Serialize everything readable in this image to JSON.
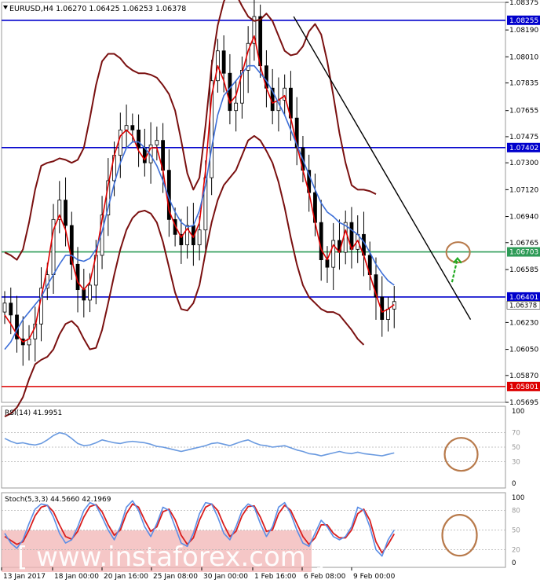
{
  "chart_data": [
    {
      "type": "line",
      "panel": "main",
      "title": "EURUSD,H4  1.06270 1.06425 1.06253 1.06378",
      "instrument": "EURUSD,H4",
      "ohlc_header": [
        "1.06270",
        "1.06425",
        "1.06253",
        "1.06378"
      ],
      "last_price": 1.06378,
      "last_price_label": "1.06378",
      "ylim": [
        1.05695,
        1.08375
      ],
      "y_ticks": [
        1.08375,
        1.0819,
        1.0801,
        1.07835,
        1.0765,
        1.07475,
        1.073,
        1.0712,
        1.0694,
        1.06765,
        1.06585,
        1.0623,
        1.0605,
        1.05875,
        1.05695
      ],
      "y_tick_labels": [
        "1.08375",
        "1.08190",
        "1.08010",
        "1.07835",
        "1.07655",
        "1.07475",
        "1.07300",
        "1.07120",
        "1.06940",
        "1.06765",
        "1.06585",
        "1.06230",
        "1.06050",
        "1.05870",
        "1.05695"
      ],
      "x_tick_labels": [
        "13 Jan 2017",
        "18 Jan 00:00",
        "20 Jan 16:00",
        "25 Jan 08:00",
        "30 Jan 00:00",
        "1 Feb 16:00",
        "6 Feb 08:00",
        "9 Feb 00:00"
      ],
      "levels": [
        {
          "value": 1.08255,
          "label": "1.08255",
          "color": "#0000cc"
        },
        {
          "value": 1.07402,
          "label": "1.07402",
          "color": "#0000cc"
        },
        {
          "value": 1.06703,
          "label": "1.06703",
          "color": "#2e9b57"
        },
        {
          "value": 1.06401,
          "label": "1.06401",
          "color": "#0000cc"
        },
        {
          "value": 1.05801,
          "label": "1.05801",
          "color": "#dd0000"
        }
      ],
      "series": [
        {
          "role": "price-close",
          "color": "#000000",
          "values": [
            1.0636,
            1.0628,
            1.0612,
            1.0608,
            1.0612,
            1.0622,
            1.0646,
            1.0655,
            1.0692,
            1.0705,
            1.0688,
            1.0662,
            1.0645,
            1.0638,
            1.0648,
            1.0668,
            1.0695,
            1.0718,
            1.0735,
            1.0752,
            1.0755,
            1.0752,
            1.074,
            1.073,
            1.0742,
            1.0745,
            1.0725,
            1.0692,
            1.0682,
            1.0675,
            1.0688,
            1.0675,
            1.0685,
            1.072,
            1.0785,
            1.0805,
            1.079,
            1.0765,
            1.077,
            1.0792,
            1.081,
            1.0828,
            1.0795,
            1.078,
            1.0765,
            1.0772,
            1.078,
            1.076,
            1.074,
            1.0725,
            1.071,
            1.069,
            1.0665,
            1.066,
            1.0678,
            1.067,
            1.069,
            1.0672,
            1.0682,
            1.0668,
            1.0655,
            1.064,
            1.0625,
            1.0632,
            1.0637
          ]
        },
        {
          "role": "moving-average-fast",
          "color": "#e00000",
          "values": [
            1.0628,
            1.0622,
            1.0615,
            1.061,
            1.0612,
            1.062,
            1.064,
            1.066,
            1.0685,
            1.0695,
            1.0685,
            1.0665,
            1.065,
            1.0645,
            1.065,
            1.0668,
            1.0692,
            1.0715,
            1.0735,
            1.0748,
            1.0752,
            1.0748,
            1.0738,
            1.0732,
            1.074,
            1.074,
            1.0725,
            1.0698,
            1.0688,
            1.068,
            1.0686,
            1.068,
            1.069,
            1.0725,
            1.0775,
            1.0795,
            1.0785,
            1.077,
            1.0775,
            1.079,
            1.0805,
            1.0815,
            1.0795,
            1.078,
            1.077,
            1.0772,
            1.0775,
            1.076,
            1.0742,
            1.0725,
            1.071,
            1.069,
            1.0672,
            1.0665,
            1.0675,
            1.067,
            1.0685,
            1.0672,
            1.0678,
            1.0668,
            1.0655,
            1.0642,
            1.063,
            1.0632,
            1.0635
          ]
        },
        {
          "role": "moving-average-slow",
          "color": "#3d6fd8",
          "values": [
            1.0605,
            1.061,
            1.0618,
            1.0625,
            1.063,
            1.0635,
            1.064,
            1.0648,
            1.0655,
            1.0662,
            1.0668,
            1.0668,
            1.0665,
            1.0664,
            1.0666,
            1.0672,
            1.0684,
            1.07,
            1.0716,
            1.073,
            1.074,
            1.0744,
            1.0744,
            1.074,
            1.0735,
            1.0728,
            1.0718,
            1.0706,
            1.0697,
            1.069,
            1.0687,
            1.0688,
            1.0698,
            1.0715,
            1.074,
            1.0762,
            1.0775,
            1.078,
            1.0785,
            1.079,
            1.0795,
            1.0795,
            1.079,
            1.0785,
            1.0778,
            1.077,
            1.0762,
            1.0752,
            1.0742,
            1.0732,
            1.0722,
            1.0712,
            1.0703,
            1.0697,
            1.0694,
            1.069,
            1.0688,
            1.0685,
            1.0682,
            1.0677,
            1.067,
            1.0662,
            1.0656,
            1.0651,
            1.0648
          ]
        },
        {
          "role": "bollinger-upper",
          "color": "#7a1010",
          "values": [
            1.067,
            1.0668,
            1.0665,
            1.0672,
            1.069,
            1.0712,
            1.0728,
            1.073,
            1.0731,
            1.0733,
            1.0732,
            1.073,
            1.0732,
            1.074,
            1.076,
            1.0782,
            1.0798,
            1.0803,
            1.0803,
            1.08,
            1.0795,
            1.0792,
            1.079,
            1.079,
            1.0789,
            1.0787,
            1.0782,
            1.0776,
            1.0765,
            1.0745,
            1.0723,
            1.0712,
            1.072,
            1.0755,
            1.0795,
            1.0822,
            1.0838,
            1.0847,
            1.0843,
            1.0835,
            1.0828,
            1.0825,
            1.0826,
            1.083,
            1.0825,
            1.0815,
            1.0805,
            1.0802,
            1.0803,
            1.0808,
            1.0818,
            1.0823,
            1.0816,
            1.0798,
            1.0775,
            1.075,
            1.073,
            1.0715,
            1.0712,
            1.0712,
            1.0711,
            1.0709
          ]
        },
        {
          "role": "bollinger-lower",
          "color": "#7a1010",
          "values": [
            1.056,
            1.0562,
            1.0566,
            1.0573,
            1.0585,
            1.0595,
            1.0598,
            1.06,
            1.0605,
            1.0615,
            1.0622,
            1.0624,
            1.062,
            1.0612,
            1.0605,
            1.0606,
            1.0618,
            1.0636,
            1.0655,
            1.0672,
            1.0685,
            1.0693,
            1.0697,
            1.0698,
            1.0696,
            1.069,
            1.0677,
            1.066,
            1.0643,
            1.0632,
            1.0631,
            1.0636,
            1.0648,
            1.067,
            1.069,
            1.0705,
            1.0715,
            1.072,
            1.0725,
            1.0735,
            1.0745,
            1.0748,
            1.0745,
            1.0738,
            1.073,
            1.0717,
            1.07,
            1.068,
            1.0662,
            1.0648,
            1.064,
            1.0636,
            1.0632,
            1.063,
            1.063,
            1.0628,
            1.0623,
            1.0618,
            1.0612,
            1.0608
          ]
        },
        {
          "role": "trendline",
          "color": "#000000",
          "x": [
            48,
            75
          ],
          "values": [
            1.0828,
            1.0625
          ]
        }
      ],
      "annotations": [
        {
          "kind": "circle",
          "color": "#b87a4b",
          "x": 74.5,
          "value": 1.067
        },
        {
          "kind": "arrow",
          "color": "#22aa22",
          "x_from": 73.5,
          "x_to": 74.4,
          "value_from": 1.065,
          "value_to": 1.0666
        }
      ]
    },
    {
      "type": "line",
      "panel": "rsi",
      "title": "RSI(14) 41.9951",
      "ylim": [
        0,
        100
      ],
      "y_tick_labels": [
        "100",
        "70",
        "50",
        "30",
        "0"
      ],
      "y_ticks": [
        100,
        70,
        50,
        30,
        0
      ],
      "series": [
        {
          "role": "rsi",
          "color": "#6a9ae0",
          "values": [
            62,
            58,
            55,
            56,
            54,
            53,
            55,
            60,
            66,
            70,
            68,
            62,
            55,
            52,
            53,
            56,
            60,
            58,
            56,
            55,
            57,
            58,
            57,
            56,
            54,
            51,
            50,
            48,
            46,
            44,
            46,
            48,
            50,
            52,
            55,
            56,
            54,
            52,
            55,
            58,
            60,
            56,
            53,
            52,
            50,
            51,
            52,
            49,
            46,
            44,
            41,
            40,
            38,
            40,
            42,
            44,
            42,
            41,
            43,
            41,
            40,
            39,
            38,
            40,
            42
          ]
        }
      ],
      "annotations": [
        {
          "kind": "circle",
          "color": "#b87a4b",
          "x": 75,
          "value": 40
        }
      ]
    },
    {
      "type": "line",
      "panel": "stochastic",
      "title": "Stoch(5,3,3) 44.5660 42.1969",
      "ylim": [
        0,
        100
      ],
      "y_tick_labels": [
        "100",
        "80",
        "50",
        "20",
        "0"
      ],
      "y_ticks": [
        100,
        80,
        50,
        20,
        0
      ],
      "series": [
        {
          "role": "stoch-main",
          "color": "#5b8ee6",
          "values": [
            45,
            30,
            22,
            35,
            60,
            82,
            90,
            88,
            70,
            45,
            30,
            35,
            55,
            80,
            92,
            88,
            70,
            50,
            35,
            55,
            85,
            95,
            80,
            55,
            40,
            60,
            85,
            80,
            55,
            30,
            25,
            45,
            75,
            92,
            90,
            70,
            45,
            35,
            55,
            80,
            90,
            85,
            60,
            40,
            55,
            85,
            92,
            75,
            50,
            30,
            25,
            45,
            65,
            55,
            40,
            35,
            40,
            55,
            85,
            80,
            55,
            20,
            10,
            35,
            50
          ]
        },
        {
          "role": "stoch-signal",
          "color": "#d91e1e",
          "values": [
            40,
            34,
            28,
            32,
            50,
            72,
            85,
            88,
            78,
            58,
            40,
            36,
            48,
            70,
            86,
            89,
            78,
            58,
            42,
            50,
            75,
            90,
            85,
            65,
            48,
            55,
            78,
            82,
            66,
            42,
            28,
            38,
            65,
            85,
            90,
            80,
            58,
            40,
            48,
            72,
            86,
            87,
            70,
            48,
            50,
            75,
            88,
            80,
            60,
            40,
            28,
            38,
            58,
            58,
            45,
            38,
            38,
            50,
            75,
            82,
            65,
            32,
            15,
            28,
            44
          ]
        }
      ],
      "annotations": [
        {
          "kind": "circle",
          "color": "#b87a4b",
          "x": 75,
          "value": 42
        }
      ]
    }
  ],
  "watermark": "[ www.instaforex.com ]",
  "colors": {
    "background": "#ffffff",
    "grid": "#9a9a9a",
    "bull_candle": "#ffffff",
    "bear_candle": "#000000"
  }
}
